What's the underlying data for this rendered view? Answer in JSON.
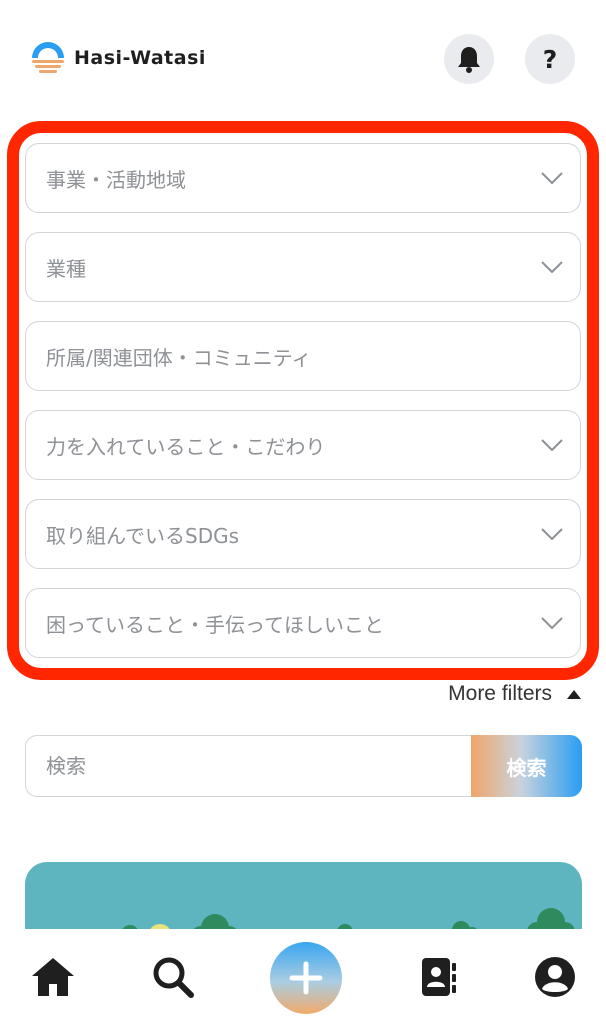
{
  "app": {
    "name": "Hasi-Watasi"
  },
  "header": {
    "help_label": "?",
    "icons": [
      "logo-icon",
      "bell-icon",
      "help-icon"
    ]
  },
  "filters": [
    {
      "label": "事業・活動地域",
      "type": "select"
    },
    {
      "label": "業種",
      "type": "select"
    },
    {
      "label": "所属/関連団体・コミュニティ",
      "type": "text"
    },
    {
      "label": "力を入れていること・こだわり",
      "type": "select"
    },
    {
      "label": "取り組んでいるSDGs",
      "type": "select"
    },
    {
      "label": "困っていること・手伝ってほしいこと",
      "type": "select"
    }
  ],
  "more_filters": {
    "label": "More filters",
    "state": "expanded"
  },
  "search": {
    "placeholder": "検索",
    "value": "",
    "button_label": "検索"
  },
  "bottom_nav": {
    "items": [
      "home-icon",
      "search-icon",
      "add-icon",
      "contacts-icon",
      "profile-icon"
    ]
  },
  "colors": {
    "highlight": "#ff2600",
    "banner": "#5fb5bf",
    "field_border": "#d3d5d9",
    "placeholder": "#8e9196",
    "accent_blue": "#2a9ef2",
    "accent_orange": "#f0a56b"
  }
}
